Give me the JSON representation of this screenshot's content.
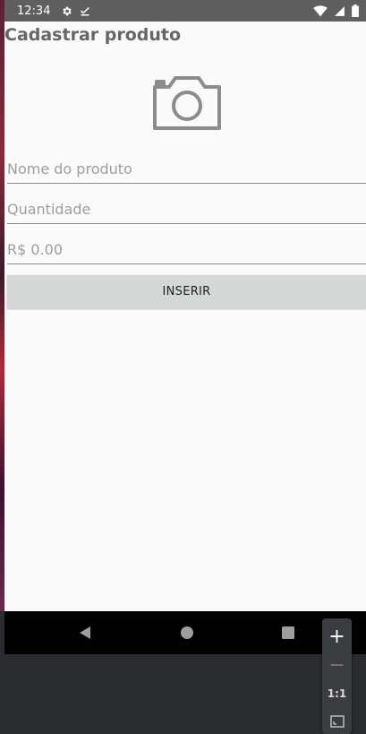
{
  "status_bar": {
    "time": "12:34",
    "icons": [
      "settings-icon",
      "download-done-icon",
      "wifi-icon",
      "signal-icon",
      "battery-icon"
    ]
  },
  "app": {
    "title": "Cadastrar produto",
    "camera_icon": "camera-icon",
    "fields": {
      "name": {
        "placeholder": "Nome do produto",
        "value": ""
      },
      "quantity": {
        "placeholder": "Quantidade",
        "value": ""
      },
      "price": {
        "placeholder": "R$ 0.00",
        "value": ""
      }
    },
    "insert_button_label": "INSERIR"
  },
  "nav_bar": {
    "icons": [
      "back-icon",
      "home-icon",
      "recents-icon"
    ]
  },
  "zoom_controls": {
    "zoom_in_label": "+",
    "zoom_out_label": "−",
    "actual_size_label": "1:1"
  },
  "colors": {
    "status_bar": "#5f5f5f",
    "app_background": "#fafafa",
    "title_text": "#666666",
    "button_background": "#d6d7d7",
    "nav_bar": "#000000",
    "emulator_background": "#2b2c2f"
  }
}
